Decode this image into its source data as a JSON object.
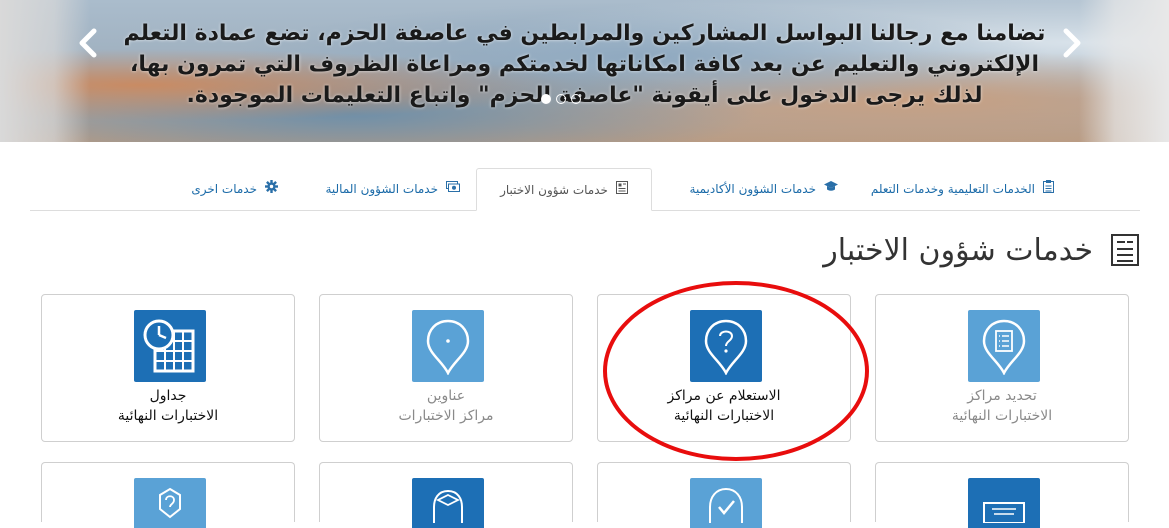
{
  "banner": {
    "lines": [
      "تضامنا مع رجالنا البواسل المشاركين والمرابطين في عاصفة الحزم، تضع عمادة التعلم",
      "الإلكتروني والتعليم عن بعد كافة امكاناتها لخدمتكم ومراعاة الظروف التي تمرون بها،",
      "لذلك يرجى الدخول على أيقونة \"عاصفة الحزم\" واتباع التعليمات الموجودة."
    ],
    "prev_arrow": "‹",
    "next_arrow": "›",
    "slides": 3,
    "active_slide": 1
  },
  "tabs": [
    {
      "label": "الخدمات التعليمية وخدمات التعلم",
      "icon": "clipboard-icon",
      "active": false
    },
    {
      "label": "خدمات الشؤون الأكاديمية",
      "icon": "graduation-cap-icon",
      "active": false
    },
    {
      "label": "خدمات شؤون الاختبار",
      "icon": "exam-icon",
      "active": true
    },
    {
      "label": "خدمات الشؤون المالية",
      "icon": "money-icon",
      "active": false
    },
    {
      "label": "خدمات اخرى",
      "icon": "gear-icon",
      "active": false
    }
  ],
  "section": {
    "title": "خدمات شؤون الاختبار",
    "icon": "exam-icon"
  },
  "cards": [
    {
      "line1": "جداول",
      "line2": "الاختبارات النهائية",
      "icon": "calendar-clock-icon",
      "enabled": true
    },
    {
      "line1": "عناوين",
      "line2": "مراكز الاختبارات",
      "icon": "map-pin-icon",
      "enabled": false
    },
    {
      "line1": "الاستعلام عن مراكز",
      "line2": "الاختبارات النهائية",
      "icon": "question-pin-icon",
      "enabled": true
    },
    {
      "line1": "تحديد مراكز",
      "line2": "الاختبارات النهائية",
      "icon": "list-pin-icon",
      "enabled": false
    }
  ],
  "cards_row2": [
    {
      "icon": "question-shield-icon",
      "enabled": false
    },
    {
      "icon": "graduation-pin-icon",
      "enabled": true
    },
    {
      "icon": "check-pin-icon",
      "enabled": false
    },
    {
      "icon": "certificate-icon",
      "enabled": true
    }
  ],
  "colors": {
    "icon_dark": "#1d6fb5",
    "icon_light": "#5aa2d6",
    "tab_link": "#1a6aa8",
    "annotation": "#e80d0d"
  }
}
